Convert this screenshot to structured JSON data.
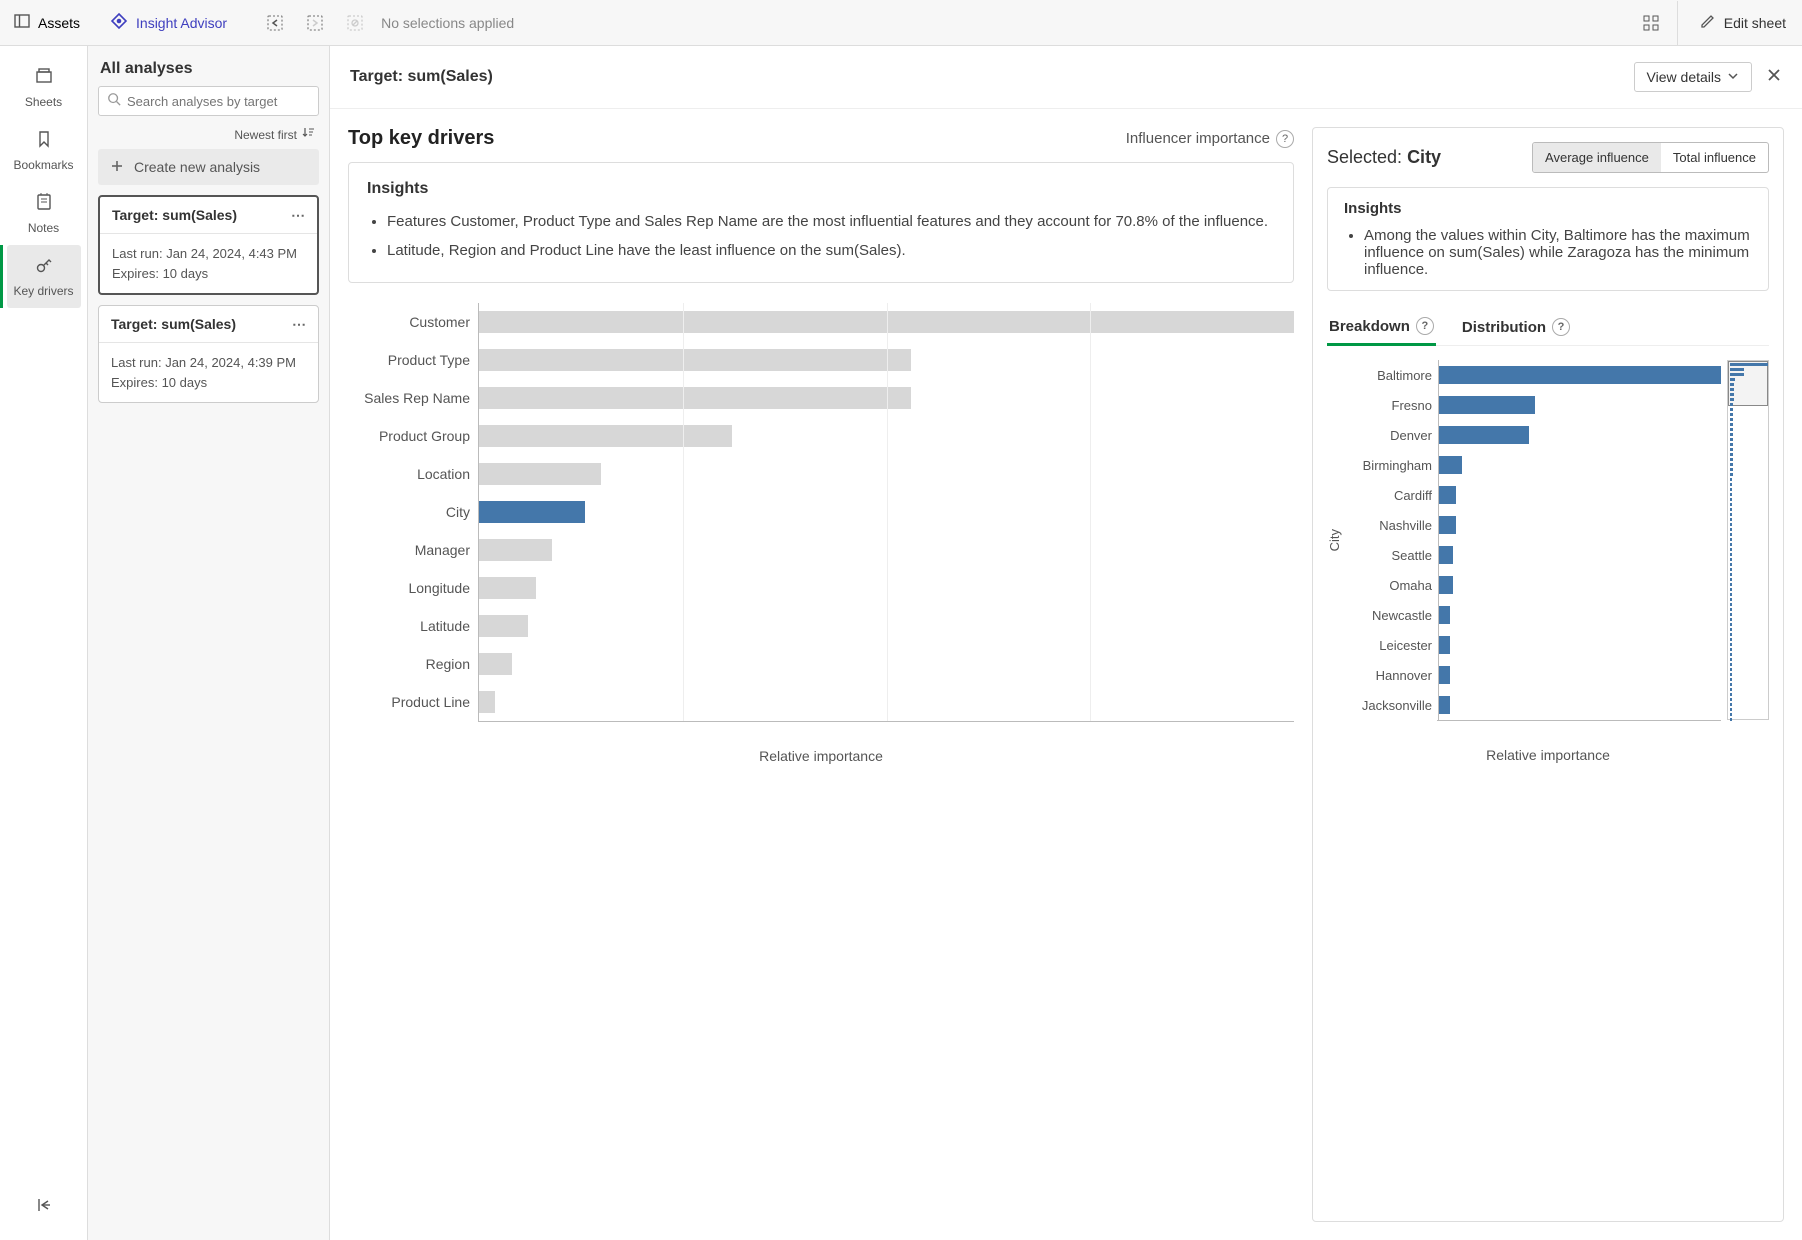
{
  "topbar": {
    "assets": "Assets",
    "insight": "Insight Advisor",
    "no_selections": "No selections applied",
    "edit": "Edit sheet"
  },
  "leftnav": {
    "sheets": "Sheets",
    "bookmarks": "Bookmarks",
    "notes": "Notes",
    "keydrivers": "Key drivers"
  },
  "analyses": {
    "title": "All analyses",
    "search_placeholder": "Search analyses by target",
    "sort": "Newest first",
    "create": "Create new analysis",
    "cards": [
      {
        "title": "Target: sum(Sales)",
        "last_run": "Last run: Jan 24, 2024, 4:43 PM",
        "expires": "Expires: 10 days"
      },
      {
        "title": "Target: sum(Sales)",
        "last_run": "Last run: Jan 24, 2024, 4:39 PM",
        "expires": "Expires: 10 days"
      }
    ]
  },
  "content": {
    "title": "Target: sum(Sales)",
    "view_details": "View details"
  },
  "left_panel": {
    "title": "Top key drivers",
    "subtitle": "Influencer importance",
    "insights_heading": "Insights",
    "insights": [
      "Features Customer, Product Type and Sales Rep Name are the most influential features and they account for 70.8% of the influence.",
      "Latitude, Region and Product Line have the least influence on the sum(Sales)."
    ],
    "xlabel": "Relative importance"
  },
  "right_panel": {
    "selected_label": "Selected: ",
    "selected_value": "City",
    "toggle_avg": "Average influence",
    "toggle_total": "Total influence",
    "insights_heading": "Insights",
    "insights": [
      "Among the values within City, Baltimore has the maximum influence on sum(Sales) while Zaragoza has the minimum influence."
    ],
    "tabs": {
      "breakdown": "Breakdown",
      "distribution": "Distribution"
    },
    "ylabel": "City",
    "xlabel": "Relative importance"
  },
  "chart_data": [
    {
      "type": "bar",
      "orientation": "horizontal",
      "title": "Top key drivers",
      "xlabel": "Relative importance",
      "ylabel": "",
      "categories": [
        "Customer",
        "Product Type",
        "Sales Rep Name",
        "Product Group",
        "Location",
        "City",
        "Manager",
        "Longitude",
        "Latitude",
        "Region",
        "Product Line"
      ],
      "values": [
        100,
        53,
        53,
        31,
        15,
        13,
        9,
        7,
        6,
        4,
        2
      ],
      "highlight": "City",
      "colors": {
        "default": "#d7d7d7",
        "highlight": "#4477aa"
      },
      "xlim": [
        0,
        100
      ]
    },
    {
      "type": "bar",
      "orientation": "horizontal",
      "title": "Breakdown",
      "xlabel": "Relative importance",
      "ylabel": "City",
      "categories": [
        "Baltimore",
        "Fresno",
        "Denver",
        "Birmingham",
        "Cardiff",
        "Nashville",
        "Seattle",
        "Omaha",
        "Newcastle",
        "Leicester",
        "Hannover",
        "Jacksonville"
      ],
      "values": [
        100,
        34,
        32,
        8,
        6,
        6,
        5,
        5,
        4,
        4,
        4,
        4
      ],
      "color": "#4477aa",
      "xlim": [
        0,
        100
      ]
    }
  ]
}
